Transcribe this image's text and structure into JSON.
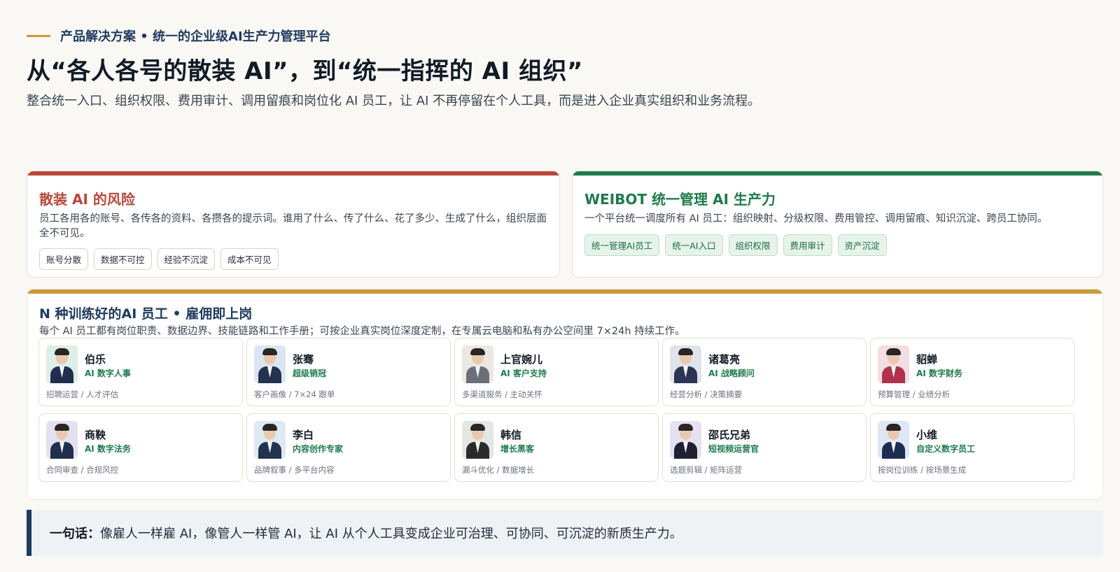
{
  "eyebrow": "产品解决方案 • 统一的企业级AI生产力管理平台",
  "headline": "从“各人各号的散装 AI”，到“统一指挥的 AI 组织”",
  "subline": "整合统一入口、组织权限、费用审计、调用留痕和岗位化 AI 员工，让 AI 不再停留在个人工具，而是进入企业真实组织和业务流程。",
  "risk": {
    "title": "散装 AI 的风险",
    "desc": "员工各用各的账号、各传各的资料、各攒各的提示词。谁用了什么、传了什么、花了多少、生成了什么，组织层面全不可见。",
    "chips": [
      "账号分散",
      "数据不可控",
      "经验不沉淀",
      "成本不可见"
    ],
    "accent": "#b8473a"
  },
  "weibot": {
    "title": "WEIBOT 统一管理 AI 生产力",
    "desc": "一个平台统一调度所有 AI 员工：组织映射、分级权限、费用管控、调用留痕、知识沉淀、跨员工协同。",
    "chips": [
      "统一管理AI员工",
      "统一AI入口",
      "组织权限",
      "费用审计",
      "资产沉淀"
    ],
    "accent": "#1f7a4d"
  },
  "staff": {
    "title": "N 种训练好的AI 员工 • 雇佣即上岗",
    "desc": "每个 AI 员工都有岗位职责、数据边界、技能链路和工作手册；可按企业真实岗位深度定制，在专属云电脑和私有办公空间里 7×24h 持续工作。",
    "agents": [
      {
        "name": "伯乐",
        "role": "AI 数字人事",
        "tags": "招聘运营 / 人才评估",
        "bg": "#dceee6",
        "suit": "#1f2f4d"
      },
      {
        "name": "张骞",
        "role": "超级销冠",
        "tags": "客户画像 / 7×24 跟单",
        "bg": "#dbe5f2",
        "suit": "#22324f"
      },
      {
        "name": "上官婉儿",
        "role": "AI 客户支持",
        "tags": "多渠道服务 / 主动关怀",
        "bg": "#ece7e2",
        "suit": "#6b6f78"
      },
      {
        "name": "诸葛亮",
        "role": "AI 战略顾问",
        "tags": "经营分析 / 决策摘要",
        "bg": "#dfe3ea",
        "suit": "#2a3552"
      },
      {
        "name": "貂蝉",
        "role": "AI 数字财务",
        "tags": "预算管理 / 业绩分析",
        "bg": "#f3dde3",
        "suit": "#b0324a"
      },
      {
        "name": "商鞅",
        "role": "AI 数字法务",
        "tags": "合同审查 / 合规风控",
        "bg": "#e3e0ef",
        "suit": "#1f2f4d"
      },
      {
        "name": "李白",
        "role": "内容创作专家",
        "tags": "品牌叙事 / 多平台内容",
        "bg": "#dde9f3",
        "suit": "#22324f"
      },
      {
        "name": "韩信",
        "role": "增长黑客",
        "tags": "漏斗优化 / 数据增长",
        "bg": "#e3e6e3",
        "suit": "#2b2b2b"
      },
      {
        "name": "邵氏兄弟",
        "role": "短视频运营官",
        "tags": "选题剪辑 / 矩阵运营",
        "bg": "#e6e1f2",
        "suit": "#1f2030"
      },
      {
        "name": "小维",
        "role": "自定义数字员工",
        "tags": "按岗位训练 / 按场景生成",
        "bg": "#dfe6f5",
        "suit": "#1d2d52"
      }
    ]
  },
  "quote": {
    "lead": "一句话：",
    "text": "像雇人一样雇 AI，像管人一样管 AI，让 AI 从个人工具变成企业可治理、可协同、可沉淀的新质生产力。"
  }
}
